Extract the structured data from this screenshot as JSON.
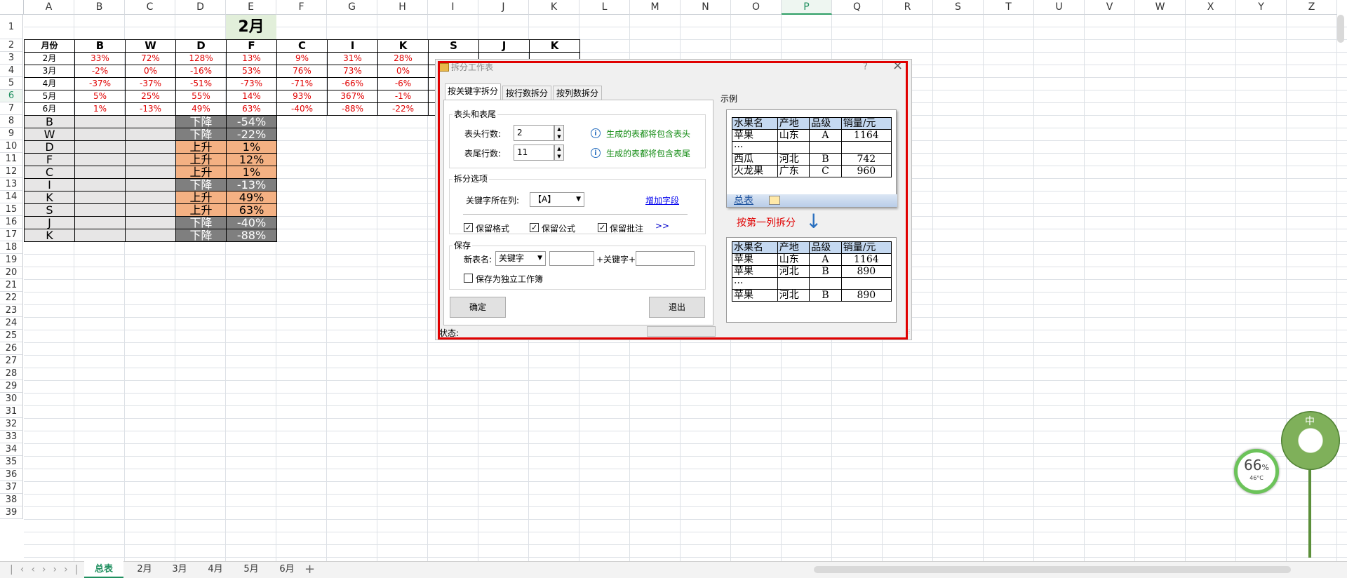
{
  "columns": [
    "A",
    "B",
    "C",
    "D",
    "E",
    "F",
    "G",
    "H",
    "I",
    "J",
    "K",
    "L",
    "M",
    "N",
    "O",
    "P",
    "Q",
    "R",
    "S",
    "T",
    "U",
    "V",
    "W",
    "X",
    "Y",
    "Z"
  ],
  "selected_col": "P",
  "rows": [
    "1",
    "2",
    "3",
    "4",
    "5",
    "6",
    "7",
    "8",
    "9",
    "10",
    "11",
    "12",
    "13",
    "14",
    "15",
    "16",
    "17",
    "18",
    "19",
    "20",
    "21",
    "22",
    "23",
    "24",
    "25",
    "26",
    "27",
    "28",
    "29",
    "30",
    "31",
    "32",
    "33",
    "34",
    "35",
    "36",
    "37",
    "38",
    "39"
  ],
  "selected_row": "6",
  "sheet": {
    "title": "2月",
    "header": [
      "月份",
      "B",
      "W",
      "D",
      "F",
      "C",
      "I",
      "K",
      "S",
      "J",
      "K"
    ],
    "month_rows": [
      [
        "2月",
        "33%",
        "72%",
        "128%",
        "13%",
        "9%",
        "31%",
        "28%",
        "",
        "",
        ""
      ],
      [
        "3月",
        "-2%",
        "0%",
        "-16%",
        "53%",
        "76%",
        "73%",
        "0%",
        "",
        "",
        ""
      ],
      [
        "4月",
        "-37%",
        "-37%",
        "-51%",
        "-73%",
        "-71%",
        "-66%",
        "-6%",
        "",
        "",
        ""
      ],
      [
        "5月",
        "5%",
        "25%",
        "55%",
        "14%",
        "93%",
        "367%",
        "-1%",
        "",
        "",
        ""
      ],
      [
        "6月",
        "1%",
        "-13%",
        "49%",
        "63%",
        "-40%",
        "-88%",
        "-22%",
        "",
        "",
        ""
      ]
    ],
    "trend_rows": [
      {
        "key": "B",
        "trend": "下降",
        "value": "-54%",
        "dir": "down"
      },
      {
        "key": "W",
        "trend": "下降",
        "value": "-22%",
        "dir": "down"
      },
      {
        "key": "D",
        "trend": "上升",
        "value": "1%",
        "dir": "up"
      },
      {
        "key": "F",
        "trend": "上升",
        "value": "12%",
        "dir": "up"
      },
      {
        "key": "C",
        "trend": "上升",
        "value": "1%",
        "dir": "up"
      },
      {
        "key": "I",
        "trend": "下降",
        "value": "-13%",
        "dir": "down"
      },
      {
        "key": "K",
        "trend": "上升",
        "value": "49%",
        "dir": "up"
      },
      {
        "key": "S",
        "trend": "上升",
        "value": "63%",
        "dir": "up"
      },
      {
        "key": "J",
        "trend": "下降",
        "value": "-40%",
        "dir": "down"
      },
      {
        "key": "K",
        "trend": "下降",
        "value": "-88%",
        "dir": "down"
      }
    ]
  },
  "dialog": {
    "title": "拆分工作表",
    "help": "?",
    "close": "×",
    "tabs": [
      "按关键字拆分",
      "按行数拆分",
      "按列数拆分"
    ],
    "group_header_footer": "表头和表尾",
    "header_rows_label": "表头行数:",
    "header_rows_value": "2",
    "footer_rows_label": "表尾行数:",
    "footer_rows_value": "11",
    "header_hint": "生成的表都将包含表头",
    "footer_hint": "生成的表都将包含表尾",
    "group_split_options": "拆分选项",
    "key_col_label": "关键字所在列:",
    "key_col_value": "【A】",
    "add_field_link": "增加字段",
    "keep_format": "保留格式",
    "keep_formula": "保留公式",
    "keep_comment": "保留批注",
    "more": ">>",
    "group_save": "保存",
    "new_name_label": "新表名:",
    "new_name_value": "关键字",
    "plus_key": "+关键字+",
    "save_independent": "保存为独立工作簿",
    "ok": "确定",
    "exit": "退出",
    "status_label": "状态:",
    "example_label": "示例",
    "example_top": {
      "header": [
        "水果名",
        "产地",
        "品级",
        "销量/元"
      ],
      "rows": [
        [
          "苹果",
          "山东",
          "A",
          "1164"
        ],
        [
          "···",
          "",
          "",
          ""
        ],
        [
          "西瓜",
          "河北",
          "B",
          "742"
        ],
        [
          "火龙果",
          "广东",
          "C",
          "960"
        ]
      ],
      "sheet_tab": "总表"
    },
    "split_caption": "按第一列拆分",
    "example_bottom": {
      "header": [
        "水果名",
        "产地",
        "品级",
        "销量/元"
      ],
      "rows": [
        [
          "苹果",
          "山东",
          "A",
          "1164"
        ],
        [
          "苹果",
          "河北",
          "B",
          "890"
        ],
        [
          "···",
          "",
          "",
          ""
        ],
        [
          "苹果",
          "河北",
          "B",
          "890"
        ]
      ]
    }
  },
  "sheet_tabs": [
    "总表",
    "2月",
    "3月",
    "4月",
    "5月",
    "6月"
  ],
  "active_sheet_tab": "总表",
  "widget": {
    "percent": "66",
    "unit": "%",
    "temp": "46°C",
    "badge": "中"
  }
}
